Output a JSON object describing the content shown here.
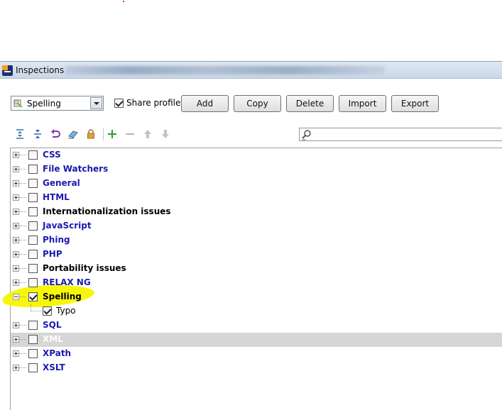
{
  "window": {
    "title": "Inspections",
    "app_icon": "phpstorm-icon"
  },
  "toolbar": {
    "profile_value": "Spelling",
    "share_profile_label": "Share profile",
    "share_profile_checked": true,
    "buttons": {
      "add": "Add",
      "copy": "Copy",
      "delete": "Delete",
      "import": "Import",
      "export": "Export"
    }
  },
  "icons": [
    "expand-all-icon",
    "collapse-all-icon",
    "reset-icon",
    "eraser-icon",
    "lock-icon",
    "add-icon",
    "remove-icon",
    "move-up-icon",
    "move-down-icon",
    "search-icon"
  ],
  "search": {
    "value": ""
  },
  "tree": {
    "items": [
      {
        "label": "CSS",
        "color": "blue",
        "checked": false
      },
      {
        "label": "File Watchers",
        "color": "blue",
        "checked": false
      },
      {
        "label": "General",
        "color": "blue",
        "checked": false
      },
      {
        "label": "HTML",
        "color": "blue",
        "checked": false
      },
      {
        "label": "Internationalization issues",
        "color": "black",
        "checked": false
      },
      {
        "label": "JavaScript",
        "color": "blue",
        "checked": false
      },
      {
        "label": "Phing",
        "color": "blue",
        "checked": false
      },
      {
        "label": "PHP",
        "color": "blue",
        "checked": false
      },
      {
        "label": "Portability issues",
        "color": "black",
        "checked": false
      },
      {
        "label": "RELAX NG",
        "color": "blue",
        "checked": false
      },
      {
        "label": "Spelling",
        "color": "black",
        "checked": true,
        "expanded": true,
        "children": [
          {
            "label": "Typo",
            "checked": true
          }
        ]
      },
      {
        "label": "SQL",
        "color": "blue",
        "checked": false
      },
      {
        "label": "XML",
        "color": "gray",
        "checked": false,
        "selected": true
      },
      {
        "label": "XPath",
        "color": "blue",
        "checked": false
      },
      {
        "label": "XSLT",
        "color": "blue",
        "checked": false
      }
    ]
  },
  "colors": {
    "blue_label": "#1a1ab0",
    "selection": "#d6d6d6",
    "highlighter": "#f5f500",
    "add_icon": "#2e9e2e"
  }
}
